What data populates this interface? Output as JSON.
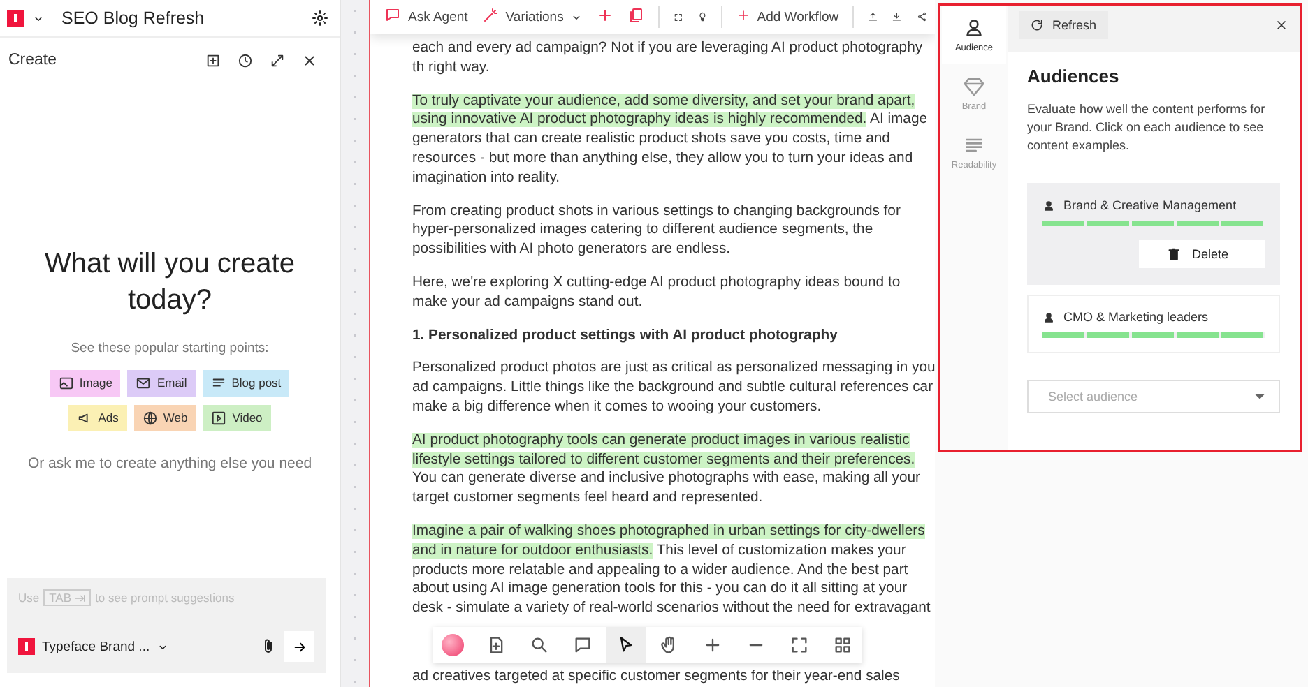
{
  "project": {
    "title": "SEO Blog Refresh"
  },
  "create_panel": {
    "title": "Create",
    "heading": "What will you create today?",
    "subtitle": "See these popular starting points:",
    "chips": [
      {
        "kind": "image",
        "label": "Image",
        "color": "#f7c8f5"
      },
      {
        "kind": "email",
        "label": "Email",
        "color": "#dccbf7"
      },
      {
        "kind": "blog",
        "label": "Blog post",
        "color": "#c8e9f8"
      },
      {
        "kind": "ads",
        "label": "Ads",
        "color": "#fbf0b4"
      },
      {
        "kind": "web",
        "label": "Web",
        "color": "#f9d4b4"
      },
      {
        "kind": "video",
        "label": "Video",
        "color": "#cdefc4"
      }
    ],
    "note": "Or ask me to create anything else you need",
    "prompt": {
      "before": "Use",
      "key": "TAB",
      "after": "to see prompt suggestions"
    },
    "brand_select": "Typeface Brand ..."
  },
  "toolbar": {
    "ask_agent": "Ask Agent",
    "variations": "Variations",
    "add_workflow": "Add Workflow"
  },
  "document": {
    "paragraphs": [
      {
        "kind": "text",
        "segments": [
          {
            "text": "each and every ad campaign? Not if you are leveraging AI product photography th right way.",
            "highlighted": false
          }
        ]
      },
      {
        "kind": "text",
        "segments": [
          {
            "text": "To truly captivate your audience, add some diversity, and set your brand apart, using innovative AI product photography ideas is highly recommended.",
            "highlighted": true
          },
          {
            "text": " AI image generators that can create realistic product shots save you costs, time and resources - but more than anything else, they allow you to turn your ideas and imagination into reality.",
            "highlighted": false
          }
        ]
      },
      {
        "kind": "text",
        "segments": [
          {
            "text": "From creating product shots in various settings to changing backgrounds for hyper-personalized images catering to different audience segments, the possibilities with AI photo generators are endless.",
            "highlighted": false
          }
        ]
      },
      {
        "kind": "text",
        "segments": [
          {
            "text": "Here, we're exploring X cutting-edge AI product photography ideas bound to make your ad campaigns stand out.",
            "highlighted": false
          }
        ]
      },
      {
        "kind": "heading",
        "segments": [
          {
            "text": "1. Personalized product settings with AI product photography",
            "highlighted": false
          }
        ]
      },
      {
        "kind": "text",
        "segments": [
          {
            "text": "Personalized product photos are just as critical as personalized messaging in you ad campaigns. Little things like the background and subtle cultural references car make a big difference when it comes to wooing your customers.",
            "highlighted": false
          }
        ]
      },
      {
        "kind": "text",
        "segments": [
          {
            "text": "AI product photography tools can generate product images in various realistic lifestyle settings tailored to different customer segments and their preferences.",
            "highlighted": true
          },
          {
            "text": " You can generate diverse and inclusive photographs with ease, making all your target customer segments feel heard and represented.",
            "highlighted": false
          }
        ]
      },
      {
        "kind": "text",
        "segments": [
          {
            "text": "Imagine a pair of walking shoes photographed in urban settings for city-dwellers and in nature for outdoor enthusiasts.",
            "highlighted": true
          },
          {
            "text": " This level of customization makes your products more relatable and appealing to a wider audience. And the best part about using AI image generation tools for this - you can do it all sitting at your desk - simulate a variety of real-world scenarios without the need for extravagant",
            "highlighted": false
          }
        ]
      }
    ],
    "tail": "ad creatives targeted at specific customer segments for their year-end sales"
  },
  "insights": {
    "tabs": [
      {
        "kind": "audience",
        "label": "Audience",
        "selected": true
      },
      {
        "kind": "brand",
        "label": "Brand",
        "selected": false
      },
      {
        "kind": "readability",
        "label": "Readability",
        "selected": false
      }
    ],
    "refresh": "Refresh",
    "title": "Audiences",
    "description": "Evaluate how well the content performs for your Brand. Click on each audience to see content examples.",
    "audiences": [
      {
        "name": "Brand & Creative Management",
        "level": 1,
        "selected": true,
        "action": "Delete"
      },
      {
        "name": "CMO & Marketing leaders",
        "level": 1,
        "selected": false
      }
    ],
    "select": {
      "placeholder": "Select audience"
    }
  }
}
